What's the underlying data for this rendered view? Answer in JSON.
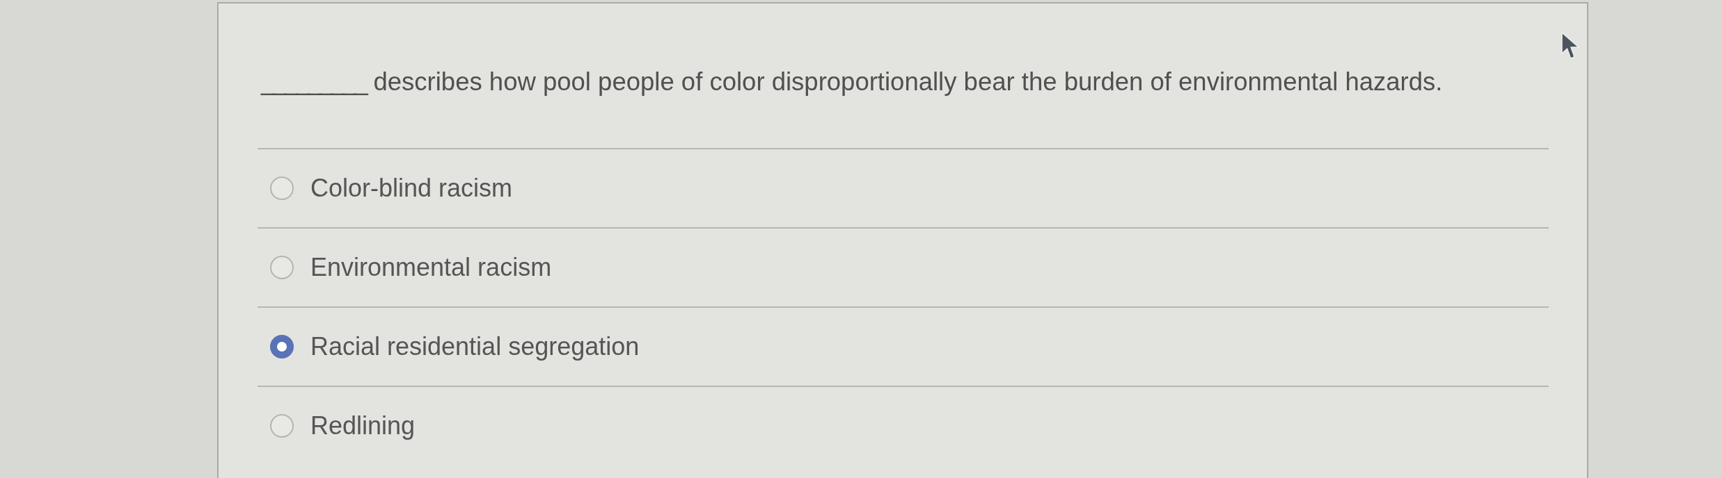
{
  "question": {
    "blank": "_________",
    "text": "describes how pool people of color disproportionally bear the burden of environmental hazards."
  },
  "options": [
    {
      "label": "Color-blind racism",
      "selected": false
    },
    {
      "label": "Environmental racism",
      "selected": false
    },
    {
      "label": "Racial residential segregation",
      "selected": true
    },
    {
      "label": "Redlining",
      "selected": false
    }
  ]
}
